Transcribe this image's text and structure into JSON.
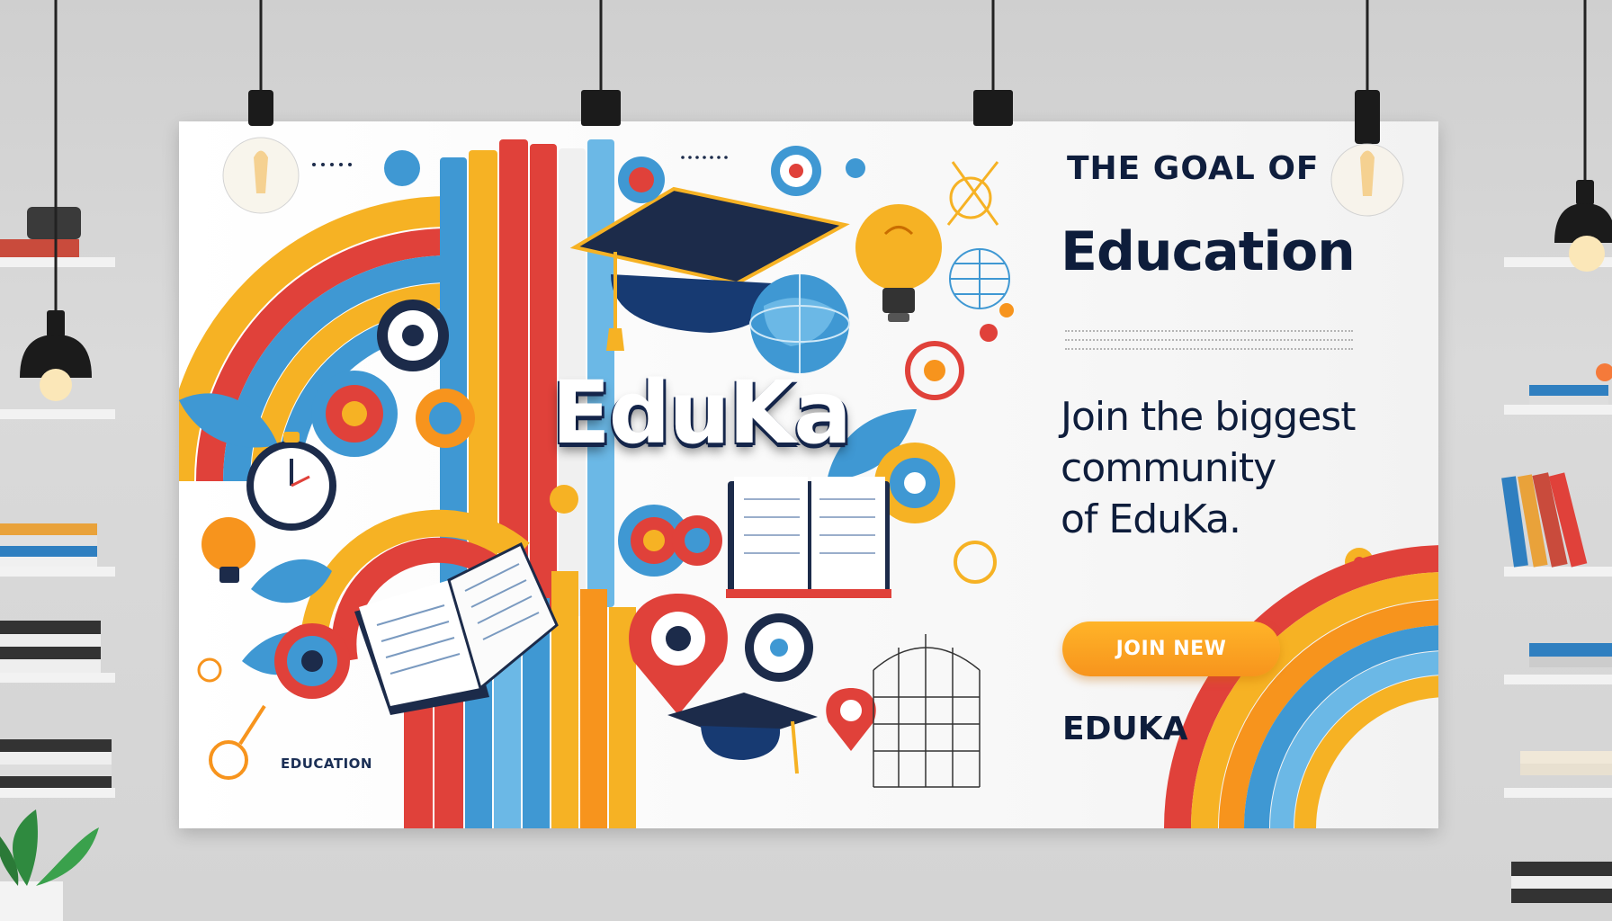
{
  "poster": {
    "brand_title": "EduKa",
    "art_label": "EDUCATION",
    "pretitle": "THE GOAL OF",
    "headline": "Education",
    "tagline": [
      "Join the biggest",
      "community",
      "of EduKa."
    ],
    "cta_label": "JOIN NEW",
    "footer_brand": "EDUKA"
  },
  "icons": [
    "graduation-cap-icon",
    "book-icon",
    "lightbulb-icon",
    "globe-icon",
    "clock-icon",
    "target-icon",
    "leaf-icon",
    "map-pin-icon",
    "compass-icon"
  ],
  "colors": {
    "navy": "#0e1d3b",
    "orange": "#f7941d",
    "red": "#e0413a",
    "blue": "#3f98d3",
    "yellow": "#f6b224",
    "wall": "#d6d6d6"
  }
}
